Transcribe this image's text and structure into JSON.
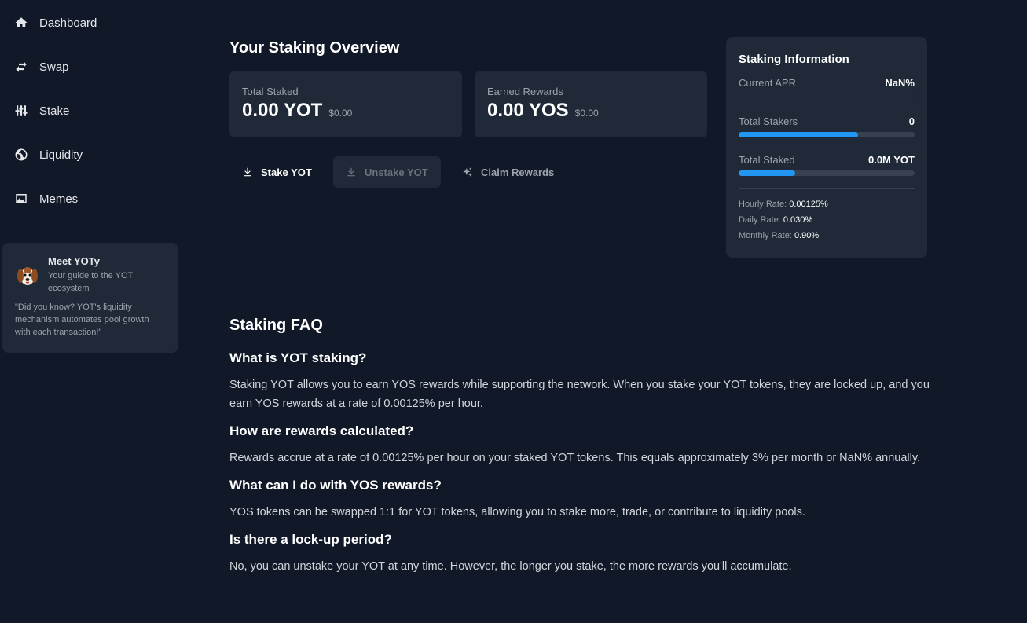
{
  "sidebar": {
    "items": [
      {
        "label": "Dashboard",
        "icon": "home-icon"
      },
      {
        "label": "Swap",
        "icon": "swap-icon"
      },
      {
        "label": "Stake",
        "icon": "sliders-icon"
      },
      {
        "label": "Liquidity",
        "icon": "globe-icon"
      },
      {
        "label": "Memes",
        "icon": "image-icon"
      }
    ],
    "yoty": {
      "title": "Meet YOTy",
      "subtitle": "Your guide to the YOT ecosystem",
      "quote": "\"Did you know? YOT's liquidity mechanism automates pool growth with each transaction!\""
    }
  },
  "overview": {
    "title": "Your Staking Overview",
    "total_staked": {
      "label": "Total Staked",
      "amount": "0.00 YOT",
      "usd": "$0.00"
    },
    "earned_rewards": {
      "label": "Earned Rewards",
      "amount": "0.00 YOS",
      "usd": "$0.00"
    }
  },
  "tabs": {
    "stake": "Stake YOT",
    "unstake": "Unstake YOT",
    "claim": "Claim Rewards"
  },
  "info": {
    "title": "Staking Information",
    "apr_label": "Current APR",
    "apr_value": "NaN%",
    "stakers_label": "Total Stakers",
    "stakers_value": "0",
    "stakers_progress": 0.68,
    "staked_label": "Total Staked",
    "staked_value": "0.0M YOT",
    "staked_progress": 0.32,
    "hourly_label": "Hourly Rate:",
    "hourly_value": "0.00125%",
    "daily_label": "Daily Rate:",
    "daily_value": "0.030%",
    "monthly_label": "Monthly Rate:",
    "monthly_value": "0.90%",
    "accent": "#2196f3"
  },
  "faq": {
    "title": "Staking FAQ",
    "items": [
      {
        "q": "What is YOT staking?",
        "a": "Staking YOT allows you to earn YOS rewards while supporting the network. When you stake your YOT tokens, they are locked up, and you earn YOS rewards at a rate of 0.00125% per hour."
      },
      {
        "q": "How are rewards calculated?",
        "a": "Rewards accrue at a rate of 0.00125% per hour on your staked YOT tokens. This equals approximately 3% per month or NaN% annually."
      },
      {
        "q": "What can I do with YOS rewards?",
        "a": "YOS tokens can be swapped 1:1 for YOT tokens, allowing you to stake more, trade, or contribute to liquidity pools."
      },
      {
        "q": "Is there a lock-up period?",
        "a": "No, you can unstake your YOT at any time. However, the longer you stake, the more rewards you'll accumulate."
      }
    ]
  }
}
